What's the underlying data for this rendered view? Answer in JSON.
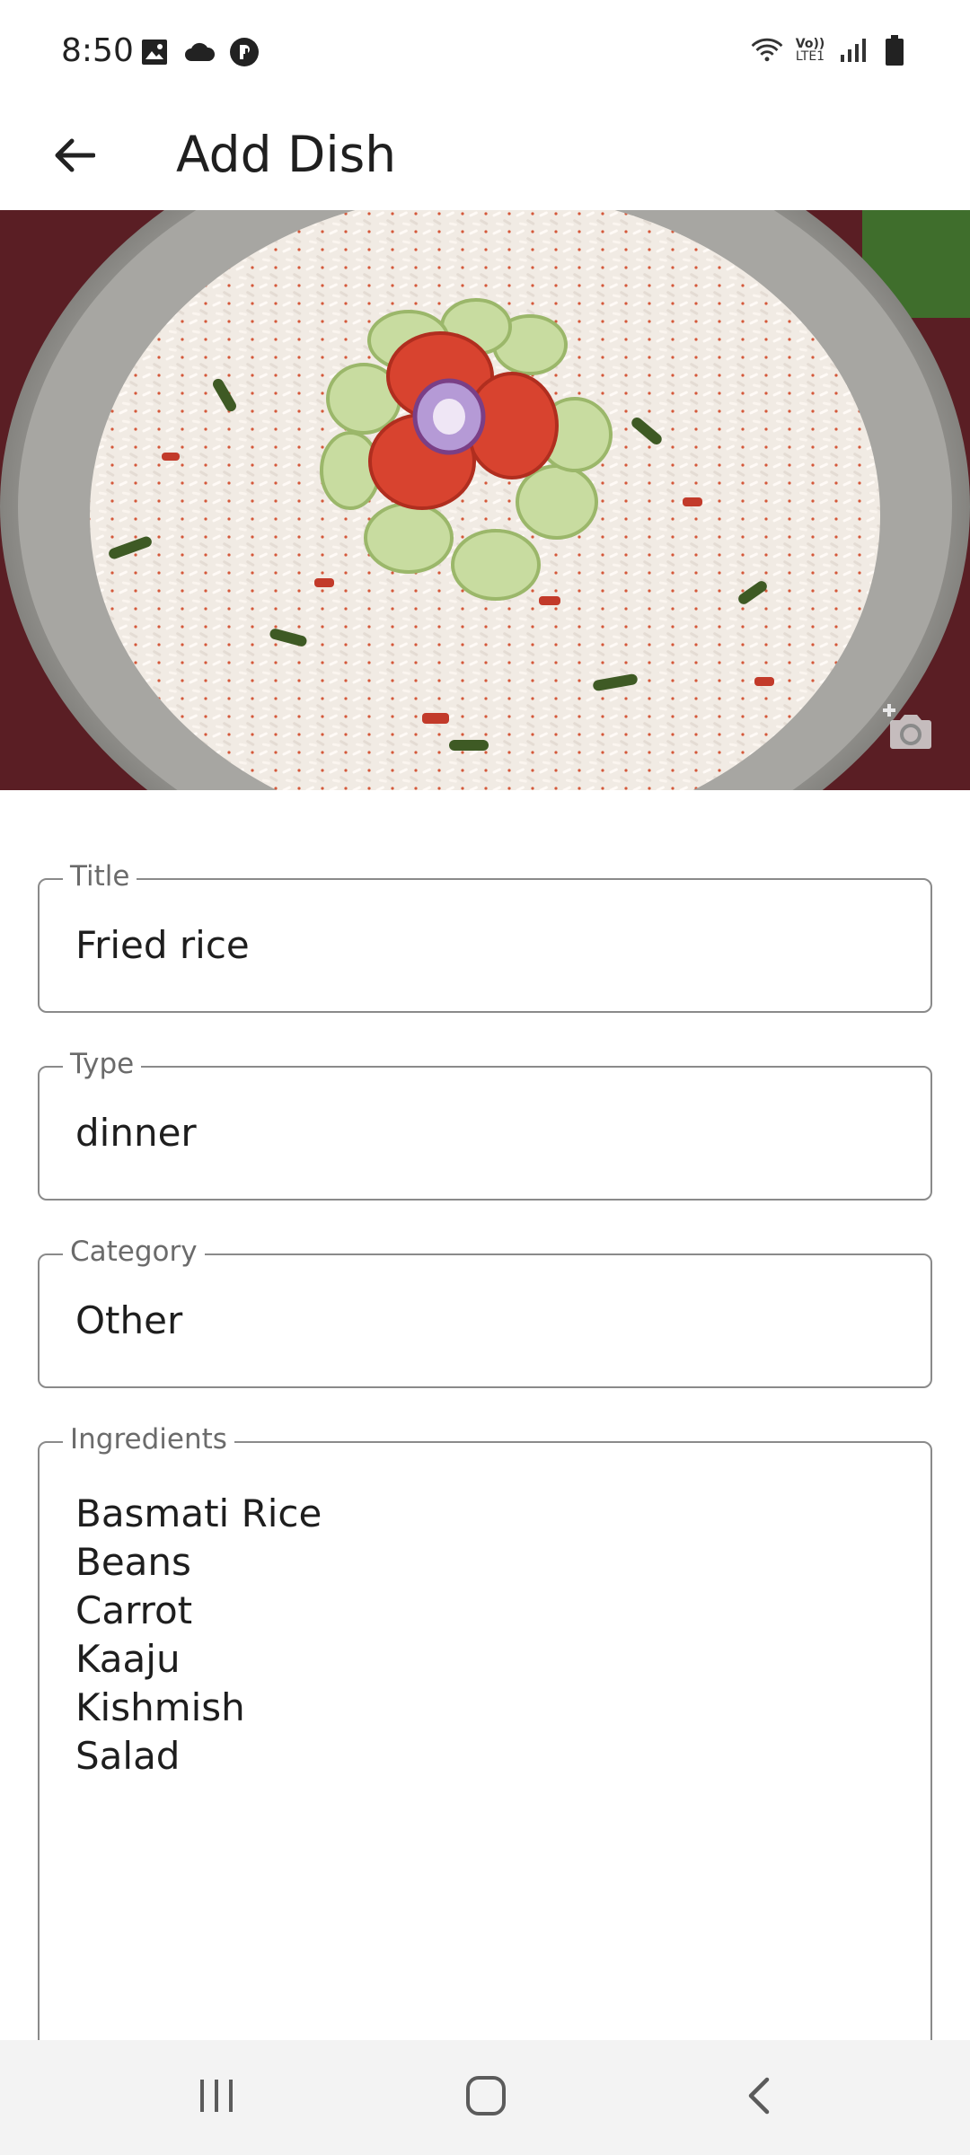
{
  "status_bar": {
    "time": "8:50",
    "left_icons": [
      "image-icon",
      "cloud-icon",
      "app-notification-icon"
    ],
    "right_icons": [
      "wifi-icon",
      "volte-lte1-icon",
      "signal-icon",
      "battery-icon"
    ],
    "volte_label": "Vo))",
    "lte_label": "LTE1"
  },
  "app_bar": {
    "title": "Add Dish",
    "back_icon": "arrow-back-icon"
  },
  "hero_image": {
    "subject": "plate of fried rice with cucumber and tomato garnish",
    "camera_icon": "add-photo-icon"
  },
  "form": {
    "title_field": {
      "label": "Title",
      "value": "Fried rice"
    },
    "type_field": {
      "label": "Type",
      "value": "dinner"
    },
    "category_field": {
      "label": "Category",
      "value": "Other"
    },
    "ingredients_field": {
      "label": "Ingredients",
      "value": "Basmati Rice\nBeans\nCarrot\nKaaju\nKishmish\nSalad"
    }
  },
  "nav_bar": {
    "icons": [
      "recent-apps-icon",
      "home-icon",
      "back-icon"
    ]
  },
  "colors": {
    "background": "#ffffff",
    "field_border": "#8a8a8a",
    "label_text": "#6b6b6b",
    "value_text": "#1e1e1e",
    "nav_background": "#f3f3f3"
  }
}
